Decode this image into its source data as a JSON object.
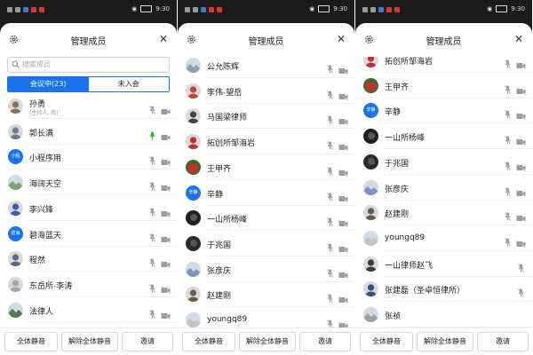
{
  "status_bar": {
    "time": "9:30"
  },
  "header": {
    "title": "管理成员"
  },
  "search": {
    "placeholder": "搜索成员"
  },
  "tabs": {
    "active": "会议中(23)",
    "inactive": "未入会"
  },
  "footer": {
    "mute_all": "全体静音",
    "unmute_all": "解除全体静音",
    "invite": "邀请"
  },
  "colors": {
    "accent": "#1a73e8",
    "mic_active": "#2eb82e",
    "mic_muted": "#c9a0a8",
    "panel_bg": "#1b1b1b"
  },
  "panels": [
    {
      "scroll_state": "top",
      "members": [
        {
          "name": "孙勇",
          "sub": "(主持人, 我)",
          "avatar": "photo-person",
          "avatar_color": "#8a6f5c",
          "mic": "muted",
          "cam": "on"
        },
        {
          "name": "郭长满",
          "avatar": "photo-person",
          "avatar_color": "#6e7d8a",
          "mic": "active",
          "cam": "on"
        },
        {
          "name": "小程序用",
          "avatar": "text",
          "avatar_text": "小程",
          "mic": "muted",
          "cam": "off"
        },
        {
          "name": "海阔天空",
          "avatar": "photo-landscape",
          "avatar_color": "#7da36b",
          "mic": "muted",
          "cam": "off"
        },
        {
          "name": "李兴锋",
          "avatar": "photo-person",
          "avatar_color": "#3b5ea8",
          "mic": "muted",
          "cam": "off"
        },
        {
          "name": "碧海蓝天",
          "avatar": "text",
          "avatar_text": "碧海",
          "mic": "muted",
          "cam": "off"
        },
        {
          "name": "程然",
          "avatar": "photo-person",
          "avatar_color": "#5a6b8a",
          "mic": "muted",
          "cam": "off"
        },
        {
          "name": "东岳所-李涛",
          "avatar": "photo-person",
          "avatar_color": "#9aa7b3",
          "mic": "muted",
          "cam": "off"
        },
        {
          "name": "法律人",
          "avatar": "photo-landscape",
          "avatar_color": "#4f7a52",
          "mic": "muted",
          "cam": "off"
        }
      ]
    },
    {
      "scroll_state": "middle",
      "members": [
        {
          "name": "公允陈辉",
          "avatar": "photo-landscape",
          "avatar_color": "#8aa0b5",
          "mic": "muted",
          "cam": "off"
        },
        {
          "name": "李伟-望岳",
          "avatar": "photo-person",
          "avatar_color": "#b04a3a",
          "mic": "muted",
          "cam": "off"
        },
        {
          "name": "马国梁律师",
          "avatar": "photo-person",
          "avatar_color": "#444444",
          "mic": "muted",
          "cam": "off"
        },
        {
          "name": "拓创所邹海岩",
          "avatar": "photo-person",
          "avatar_color": "#c03030",
          "mic": "muted",
          "cam": "off"
        },
        {
          "name": "王甲齐",
          "avatar": "photo-fruit",
          "avatar_color": "#c8302a",
          "mic": "muted",
          "cam": "off"
        },
        {
          "name": "辛静",
          "avatar": "text",
          "avatar_text": "辛静",
          "mic": "muted",
          "cam": "off"
        },
        {
          "name": "一山所杨峰",
          "avatar": "photo-dark",
          "avatar_color": "#1e1e1e",
          "mic": "muted",
          "cam": "off"
        },
        {
          "name": "于兆国",
          "avatar": "photo-dark",
          "avatar_color": "#2a2a2a",
          "mic": "muted",
          "cam": "off"
        },
        {
          "name": "张彦庆",
          "avatar": "photo-landscape",
          "avatar_color": "#7f95b8",
          "mic": "muted",
          "cam": "off"
        },
        {
          "name": "赵建刚",
          "avatar": "photo-person",
          "avatar_color": "#6b5a4a",
          "mic": "muted",
          "cam": "off"
        },
        {
          "name": "youngq89",
          "avatar": "photo-landscape",
          "avatar_color": "#c4c4c4",
          "mic": "muted",
          "cam": "off"
        }
      ]
    },
    {
      "scroll_state": "bottom",
      "members": [
        {
          "name": "拓创所邹海岩",
          "avatar": "photo-person",
          "avatar_color": "#c03030",
          "mic": "muted",
          "cam": "off"
        },
        {
          "name": "王甲齐",
          "avatar": "photo-fruit",
          "avatar_color": "#c8302a",
          "mic": "muted",
          "cam": "off"
        },
        {
          "name": "辛静",
          "avatar": "text",
          "avatar_text": "辛静",
          "mic": "muted",
          "cam": "off"
        },
        {
          "name": "一山所杨峰",
          "avatar": "photo-dark",
          "avatar_color": "#1e1e1e",
          "mic": "muted",
          "cam": "off"
        },
        {
          "name": "于兆国",
          "avatar": "photo-dark",
          "avatar_color": "#2a2a2a",
          "mic": "muted",
          "cam": "off"
        },
        {
          "name": "张彦庆",
          "avatar": "photo-landscape",
          "avatar_color": "#7f95b8",
          "mic": "muted",
          "cam": "off"
        },
        {
          "name": "赵建刚",
          "avatar": "photo-person",
          "avatar_color": "#6b5a4a",
          "mic": "muted",
          "cam": "off"
        },
        {
          "name": "youngq89",
          "avatar": "photo-landscape",
          "avatar_color": "#c4c4c4",
          "mic": "muted",
          "cam": "off"
        },
        {
          "name": "一山律师赵飞",
          "avatar": "photo-person",
          "avatar_color": "#3a3a3a",
          "mic": "muted",
          "cam": "none"
        },
        {
          "name": "张建磊（圣卓恒律所）",
          "avatar": "photo-person",
          "avatar_color": "#2e4f8a",
          "mic": "muted",
          "cam": "none"
        },
        {
          "name": "张祯",
          "avatar": "photo-landscape",
          "avatar_color": "#a0a0a0",
          "mic": "none",
          "cam": "none"
        }
      ]
    }
  ]
}
